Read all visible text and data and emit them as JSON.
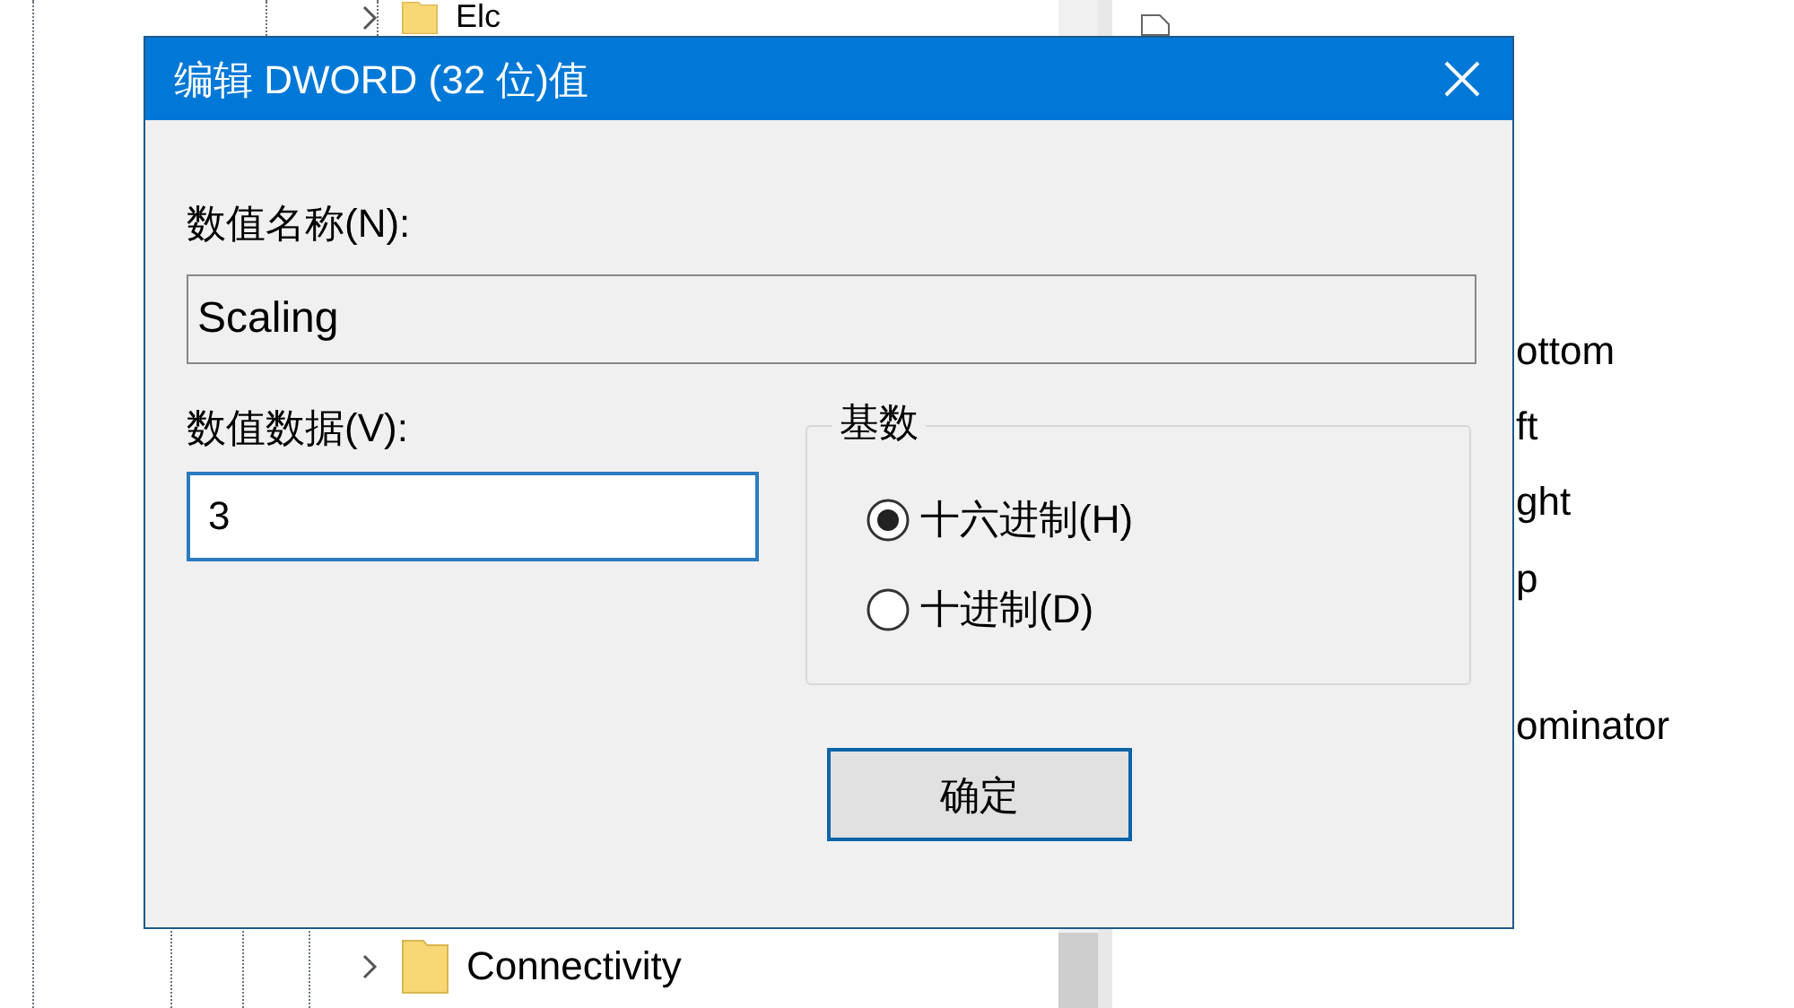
{
  "tree": {
    "items": [
      {
        "label": "Elc",
        "expanded": false
      },
      {
        "label": "Connectivity",
        "expanded": false
      }
    ]
  },
  "list": {
    "items": [
      "ottom",
      "ft",
      "ght",
      "p",
      "ominator"
    ]
  },
  "dialog": {
    "title": "编辑 DWORD (32 位)值",
    "name_label": "数值名称(N):",
    "name_value": "Scaling",
    "data_label": "数值数据(V):",
    "data_value": "3",
    "base": {
      "legend": "基数",
      "options": [
        {
          "label": "十六进制(H)",
          "selected": true
        },
        {
          "label": "十进制(D)",
          "selected": false
        }
      ]
    },
    "buttons": [
      "确定"
    ]
  }
}
